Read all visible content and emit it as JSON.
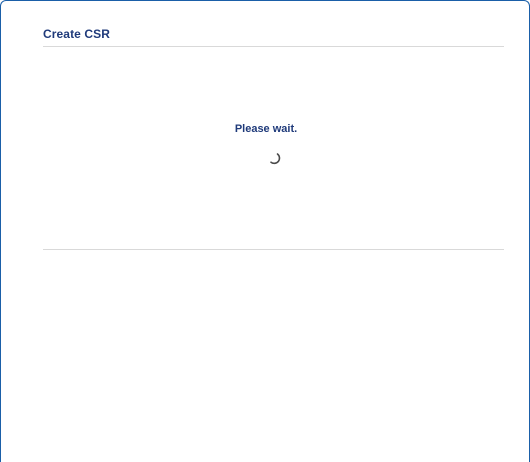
{
  "dialog": {
    "title": "Create CSR",
    "status_text": "Please wait.",
    "spinner_icon": "loading-spinner-icon"
  },
  "colors": {
    "frame_border": "#1a5fa8",
    "title_text": "#1f3a7a",
    "divider": "#d9d9d9"
  }
}
